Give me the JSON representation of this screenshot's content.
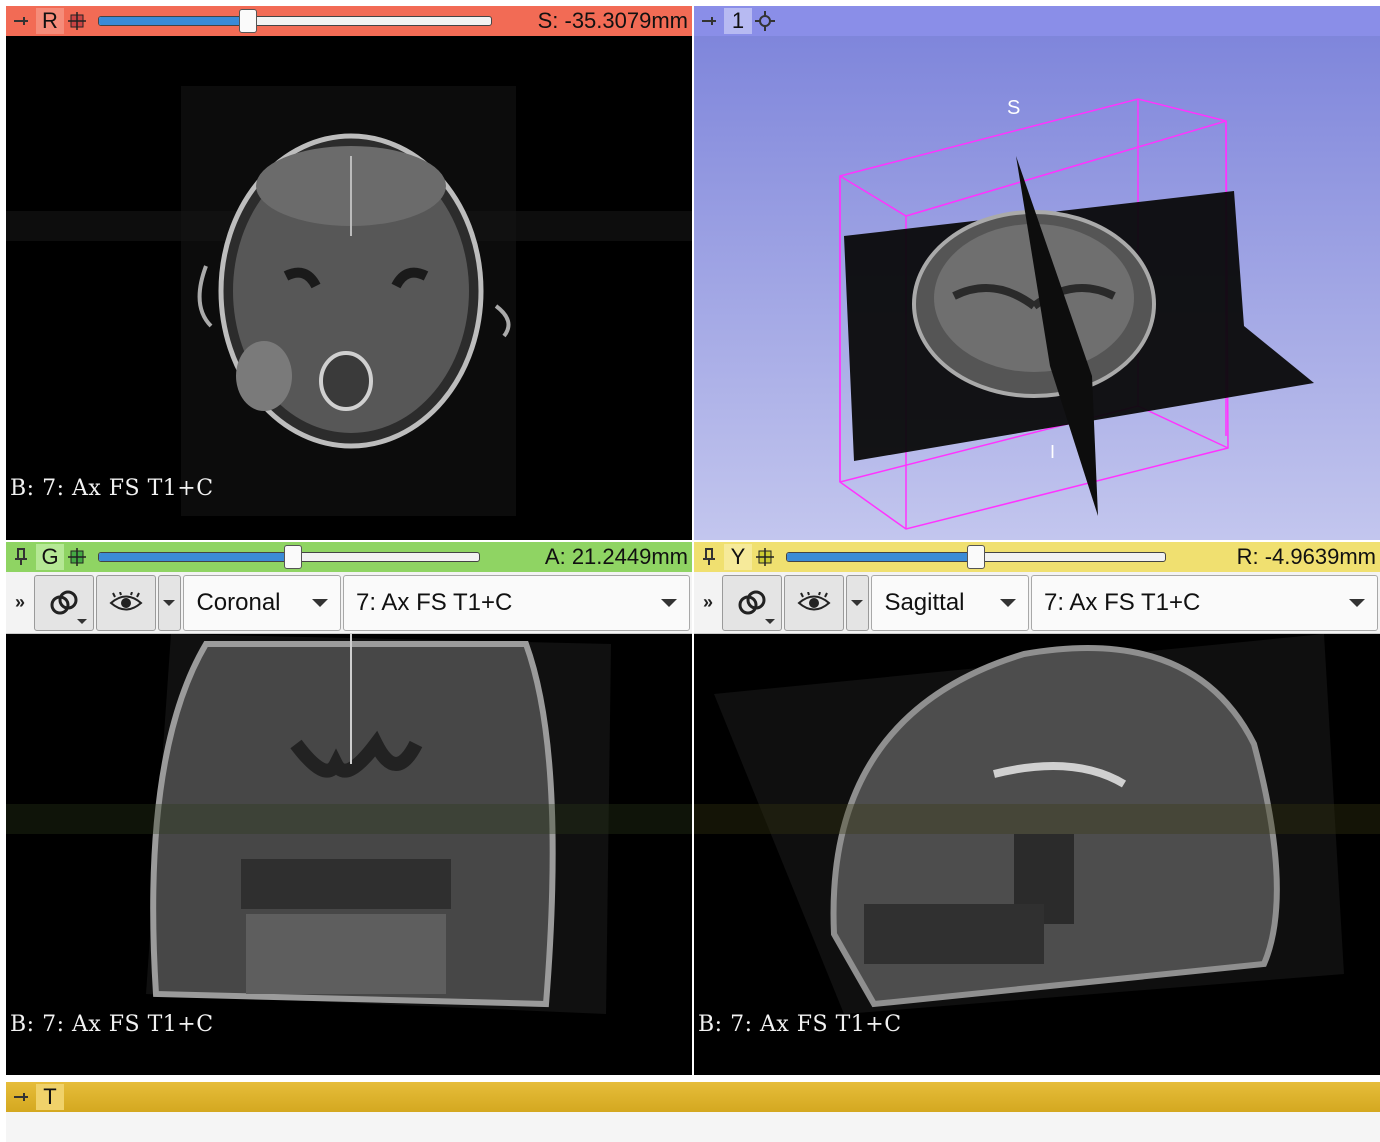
{
  "red": {
    "letter": "R",
    "offset": "S: -35.3079mm",
    "slider_fraction": 0.38,
    "layer_label": "B: 7: Ax FS T1+C",
    "color": "#f26b55"
  },
  "threeD": {
    "letter": "1",
    "label_s": "S",
    "label_i": "I",
    "color": "#8a8ee8"
  },
  "green": {
    "letter": "G",
    "offset": "A: 21.2449mm",
    "slider_fraction": 0.51,
    "orientation": "Coronal",
    "volume": "7: Ax FS T1+C",
    "layer_label": "B: 7: Ax FS T1+C",
    "color": "#8fd463"
  },
  "yellow": {
    "letter": "Y",
    "offset": "R: -4.9639mm",
    "slider_fraction": 0.5,
    "orientation": "Sagittal",
    "volume": "7: Ax FS T1+C",
    "layer_label": "B: 7: Ax FS T1+C",
    "color": "#f0e070"
  },
  "table": {
    "letter": "T",
    "color": "#e0b830"
  },
  "icons": {
    "pin": "pin-icon",
    "link": "link-icon",
    "eye": "eye-icon",
    "more": "more-icon",
    "settings": "settings-icon"
  },
  "more_symbol": "»"
}
